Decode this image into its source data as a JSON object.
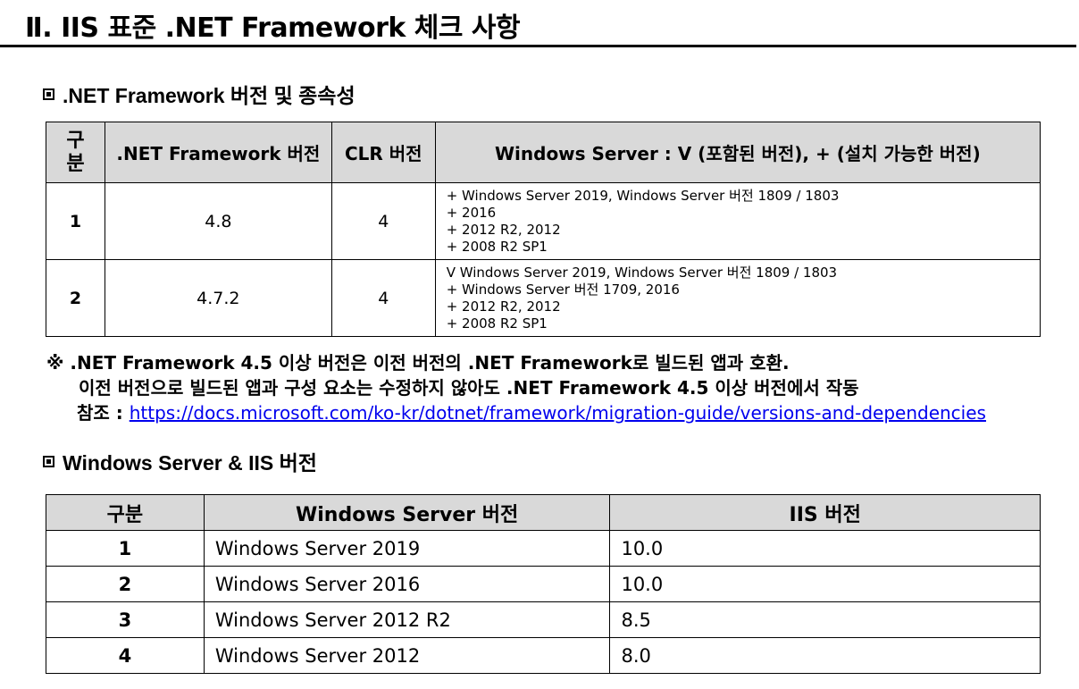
{
  "page": {
    "title": "Ⅱ. IIS 표준 .NET Framework 체크 사항"
  },
  "section1": {
    "heading": ".NET Framework 버전 및 종속성",
    "table": {
      "headers": [
        "구\n분",
        ".NET Framework 버전",
        "CLR 버전",
        "Windows Server : V (포함된 버전), + (설치 가능한 버전)"
      ],
      "rows": [
        {
          "no": "1",
          "framework": "4.8",
          "clr": "4",
          "os": [
            "+ Windows Server 2019, Windows Server 버전 1809 / 1803",
            "+ 2016",
            "+ 2012 R2, 2012",
            "+ 2008 R2 SP1"
          ]
        },
        {
          "no": "2",
          "framework": "4.7.2",
          "clr": "4",
          "os": [
            "V Windows Server 2019, Windows Server 버전 1809 / 1803",
            "+ Windows Server 버전 1709, 2016",
            "+ 2012 R2, 2012",
            "+ 2008 R2 SP1"
          ]
        }
      ]
    }
  },
  "note": {
    "line1": "※ .NET Framework 4.5 이상 버전은 이전 버전의 .NET Framework로 빌드된 앱과 호환.",
    "line2": "이전 버전으로 빌드된 앱과 구성 요소는 수정하지 않아도 .NET Framework 4.5 이상 버전에서 작동",
    "ref_label": "참조 : ",
    "ref_url": "https://docs.microsoft.com/ko-kr/dotnet/framework/migration-guide/versions-and-dependencies"
  },
  "section2": {
    "heading": "Windows Server & IIS 버전",
    "table": {
      "headers": [
        "구분",
        "Windows Server 버전",
        "IIS 버전"
      ],
      "rows": [
        {
          "no": "1",
          "server": "Windows Server 2019",
          "iis": "10.0"
        },
        {
          "no": "2",
          "server": "Windows Server 2016",
          "iis": "10.0"
        },
        {
          "no": "3",
          "server": "Windows Server 2012 R2",
          "iis": "8.5"
        },
        {
          "no": "4",
          "server": "Windows Server 2012",
          "iis": "8.0"
        }
      ]
    }
  }
}
